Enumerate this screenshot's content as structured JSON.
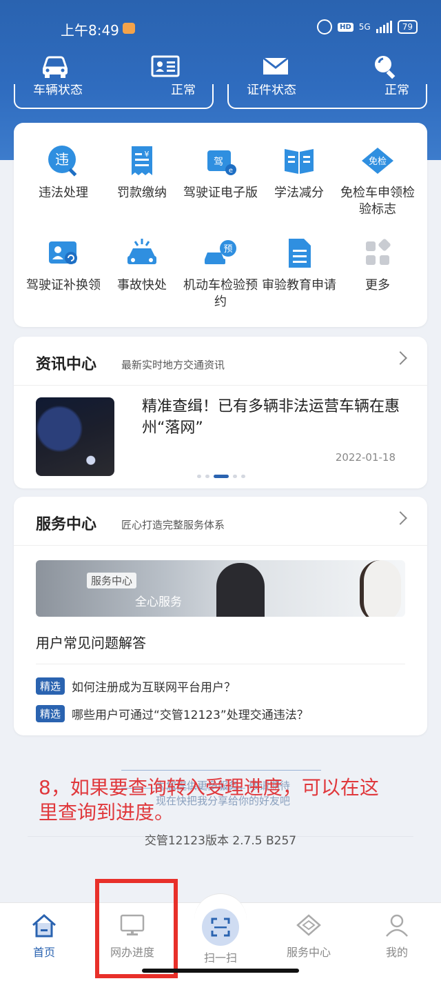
{
  "status_bar": {
    "time": "上午8:49",
    "network": "5G",
    "hd": "HD",
    "battery": "79"
  },
  "header": {
    "icons": [
      "car-icon",
      "license-card-icon",
      "mail-icon",
      "search-icon"
    ],
    "strip_left": {
      "label": "车辆状态",
      "value": "正常"
    },
    "strip_right": {
      "label": "证件状态",
      "value": "正常"
    }
  },
  "services": [
    {
      "label": "违法处理",
      "icon": "violation-icon"
    },
    {
      "label": "罚款缴纳",
      "icon": "fine-payment-icon"
    },
    {
      "label": "驾驶证电子版",
      "icon": "e-license-icon"
    },
    {
      "label": "学法减分",
      "icon": "study-book-icon"
    },
    {
      "label": "免检车申领检验标志",
      "icon": "inspection-exempt-icon"
    },
    {
      "label": "驾驶证补换领",
      "icon": "license-renew-icon"
    },
    {
      "label": "事故快处",
      "icon": "accident-icon"
    },
    {
      "label": "机动车检验预约",
      "icon": "vehicle-inspection-icon"
    },
    {
      "label": "审验教育申请",
      "icon": "document-icon"
    },
    {
      "label": "更多",
      "icon": "more-grid-icon"
    }
  ],
  "news": {
    "title": "资讯中心",
    "subtitle": "最新实时地方交通资讯",
    "headline": "精准查缉！已有多辆非法运营车辆在惠州“落网”",
    "date": "2022-01-18"
  },
  "service_center": {
    "title": "服务中心",
    "subtitle": "匠心打造完整服务体系",
    "banner_tag": "服务中心",
    "banner_slogan": "全心服务",
    "faq_title": "用户常见问题解答",
    "faqs": [
      {
        "badge": "精选",
        "text": "如何注册成为互联网平台用户？"
      },
      {
        "badge": "精选",
        "text": "哪些用户可通过“交管12123”处理交通违法？"
      }
    ]
  },
  "footer": {
    "faded_line1": "为您提供更多服务，敬请期待",
    "faded_line2": "现在快把我分享给你的好友吧",
    "annotation": "8，如果要查询转入受理进度，可以在这里查询到进度。",
    "version": "交管12123版本 2.7.5 B257"
  },
  "tabs": [
    {
      "label": "首页",
      "icon": "home-icon",
      "active": true
    },
    {
      "label": "网办进度",
      "icon": "monitor-icon",
      "active": false
    },
    {
      "label": "扫一扫",
      "icon": "scan-icon",
      "active": false
    },
    {
      "label": "服务中心",
      "icon": "handshake-icon",
      "active": false
    },
    {
      "label": "我的",
      "icon": "user-icon",
      "active": false
    }
  ],
  "colors": {
    "brand": "#2a63b0",
    "annotation": "#e0383c",
    "highlight_box": "#e8302a"
  }
}
